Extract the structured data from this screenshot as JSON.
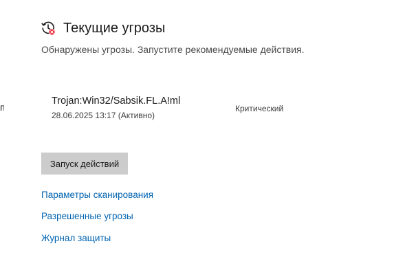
{
  "edge_fragment": "п",
  "header": {
    "icon": "clock-threat-icon",
    "title": "Текущие угрозы"
  },
  "subtitle": "Обнаружены угрозы. Запустите рекомендуемые действия.",
  "threats": [
    {
      "name": "Trojan:Win32/Sabsik.FL.A!ml",
      "date": "28.06.2025 13:17 (Активно)",
      "severity": "Критический"
    }
  ],
  "actions": {
    "start_label": "Запуск действий"
  },
  "links": {
    "scan_options": "Параметры сканирования",
    "allowed_threats": "Разрешенные угрозы",
    "protection_history": "Журнал защиты"
  },
  "colors": {
    "link": "#0063b1",
    "button_bg": "#cccccc",
    "alert_red": "#e81123"
  }
}
